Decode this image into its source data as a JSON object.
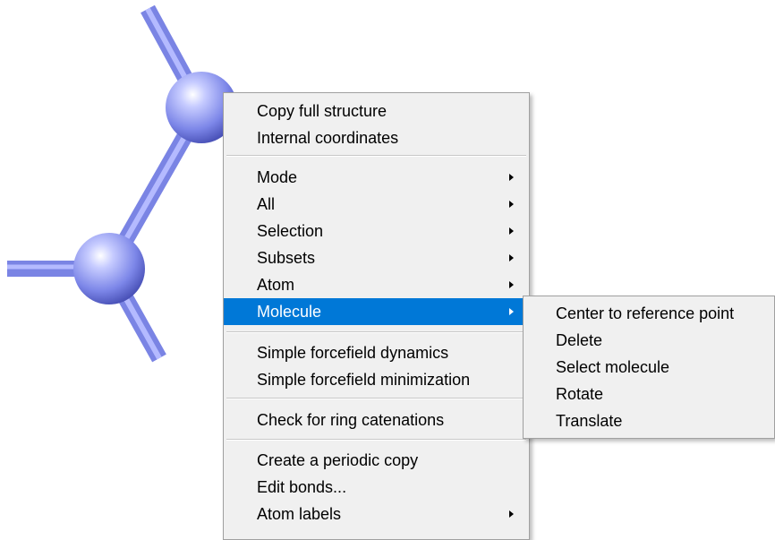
{
  "colors": {
    "atom": "#8c96f0",
    "bond": "#8c96f0",
    "menu_bg": "#f0f0f0",
    "highlight": "#0078d7"
  },
  "context_menu": {
    "items": [
      {
        "label": "Copy full structure"
      },
      {
        "label": "Internal coordinates"
      },
      {
        "label": "Mode",
        "submenu": true
      },
      {
        "label": "All",
        "submenu": true
      },
      {
        "label": "Selection",
        "submenu": true
      },
      {
        "label": "Subsets",
        "submenu": true
      },
      {
        "label": "Atom",
        "submenu": true
      },
      {
        "label": "Molecule",
        "submenu": true,
        "highlighted": true
      },
      {
        "label": "Simple forcefield dynamics"
      },
      {
        "label": "Simple forcefield minimization"
      },
      {
        "label": "Check for ring catenations"
      },
      {
        "label": "Create a periodic copy"
      },
      {
        "label": "Edit bonds..."
      },
      {
        "label": "Atom labels",
        "submenu": true
      }
    ]
  },
  "submenu": {
    "items": [
      {
        "label": "Center to reference point"
      },
      {
        "label": "Delete"
      },
      {
        "label": "Select molecule"
      },
      {
        "label": "Rotate"
      },
      {
        "label": "Translate"
      }
    ]
  }
}
